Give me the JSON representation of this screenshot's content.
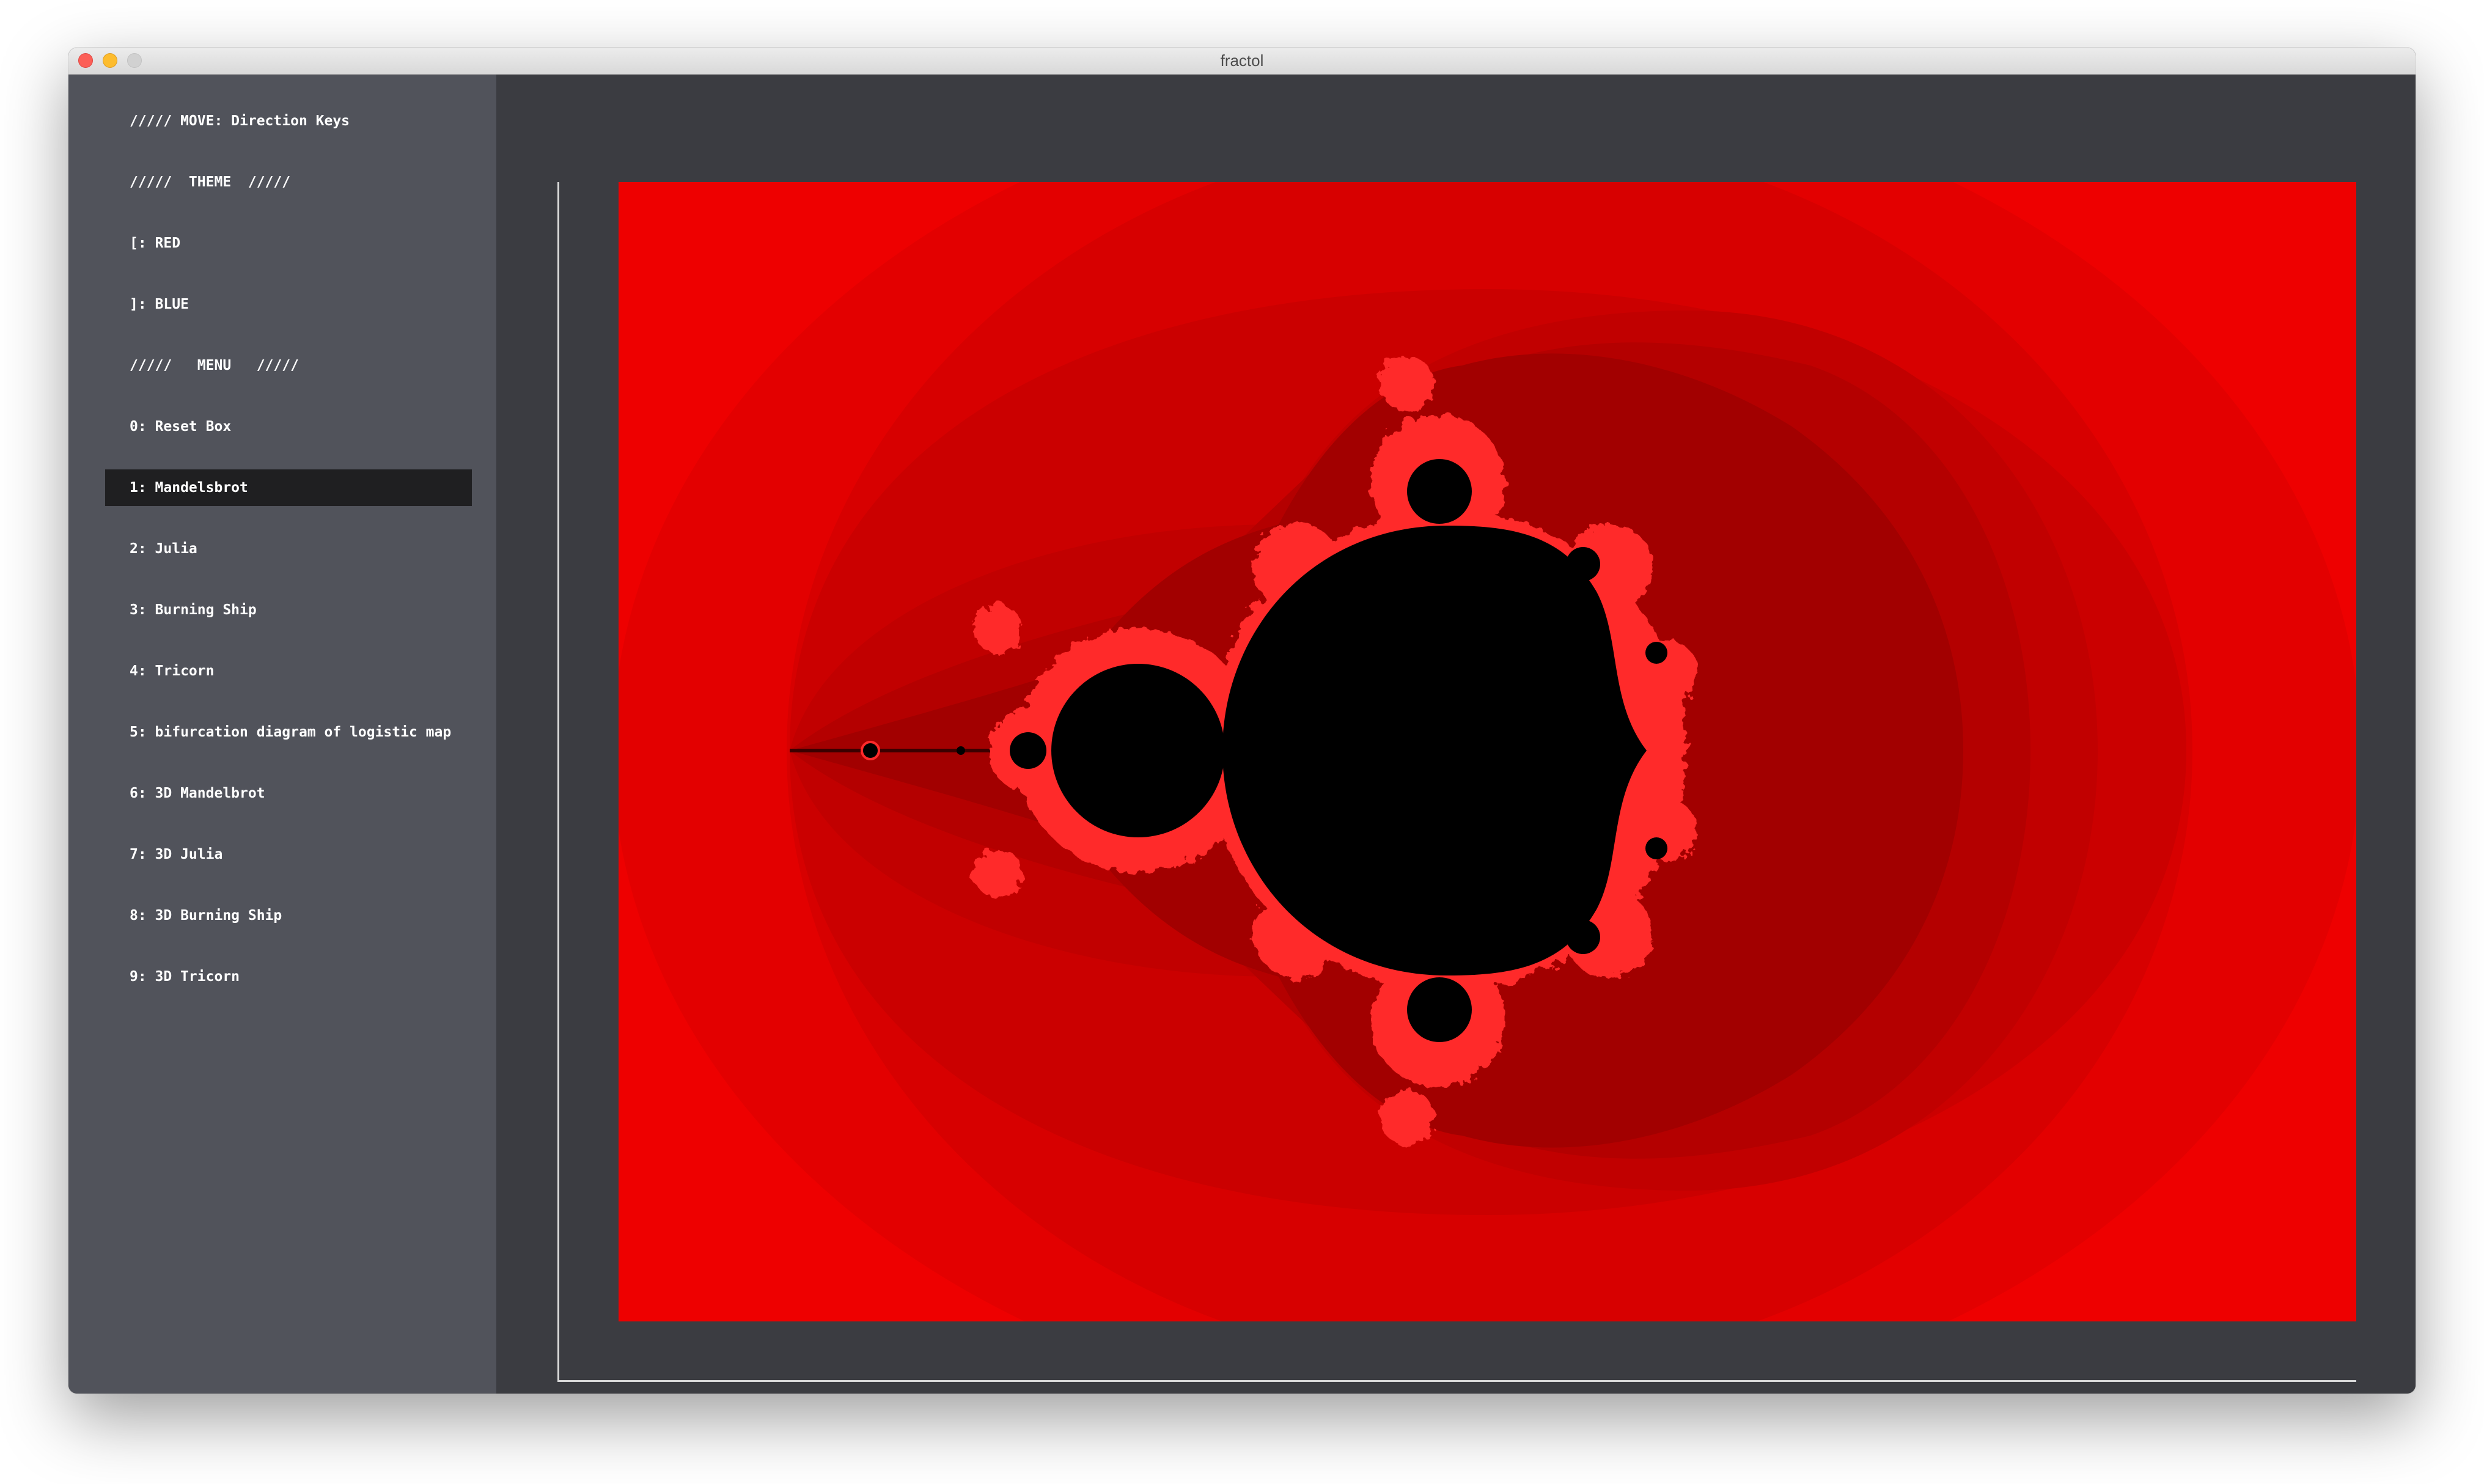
{
  "window": {
    "title": "fractol"
  },
  "sidebar": {
    "items": [
      {
        "label": "///// MOVE: Direction Keys",
        "selected": false
      },
      {
        "label": "/////  THEME  /////",
        "selected": false
      },
      {
        "label": "[: RED",
        "selected": false
      },
      {
        "label": "]: BLUE",
        "selected": false
      },
      {
        "label": "/////   MENU   /////",
        "selected": false
      },
      {
        "label": "0: Reset Box",
        "selected": false
      },
      {
        "label": "1: Mandelsbrot",
        "selected": true
      },
      {
        "label": "2: Julia",
        "selected": false
      },
      {
        "label": "3: Burning Ship",
        "selected": false
      },
      {
        "label": "4: Tricorn",
        "selected": false
      },
      {
        "label": "5: bifurcation diagram of logistic map",
        "selected": false
      },
      {
        "label": "6: 3D Mandelbrot",
        "selected": false
      },
      {
        "label": "7: 3D Julia",
        "selected": false
      },
      {
        "label": "8: 3D Burning Ship",
        "selected": false
      },
      {
        "label": "9: 3D Tricorn",
        "selected": false
      }
    ]
  },
  "canvas": {
    "fractal": "mandelbrot",
    "theme": "red",
    "colors": {
      "background": "#3b3c41",
      "sidebar": "#51535b",
      "selected_item": "#1f1f21",
      "set_interior": "#000000",
      "band_outer": "#ee0000",
      "edge_highlight": "#ff2a2a"
    }
  }
}
